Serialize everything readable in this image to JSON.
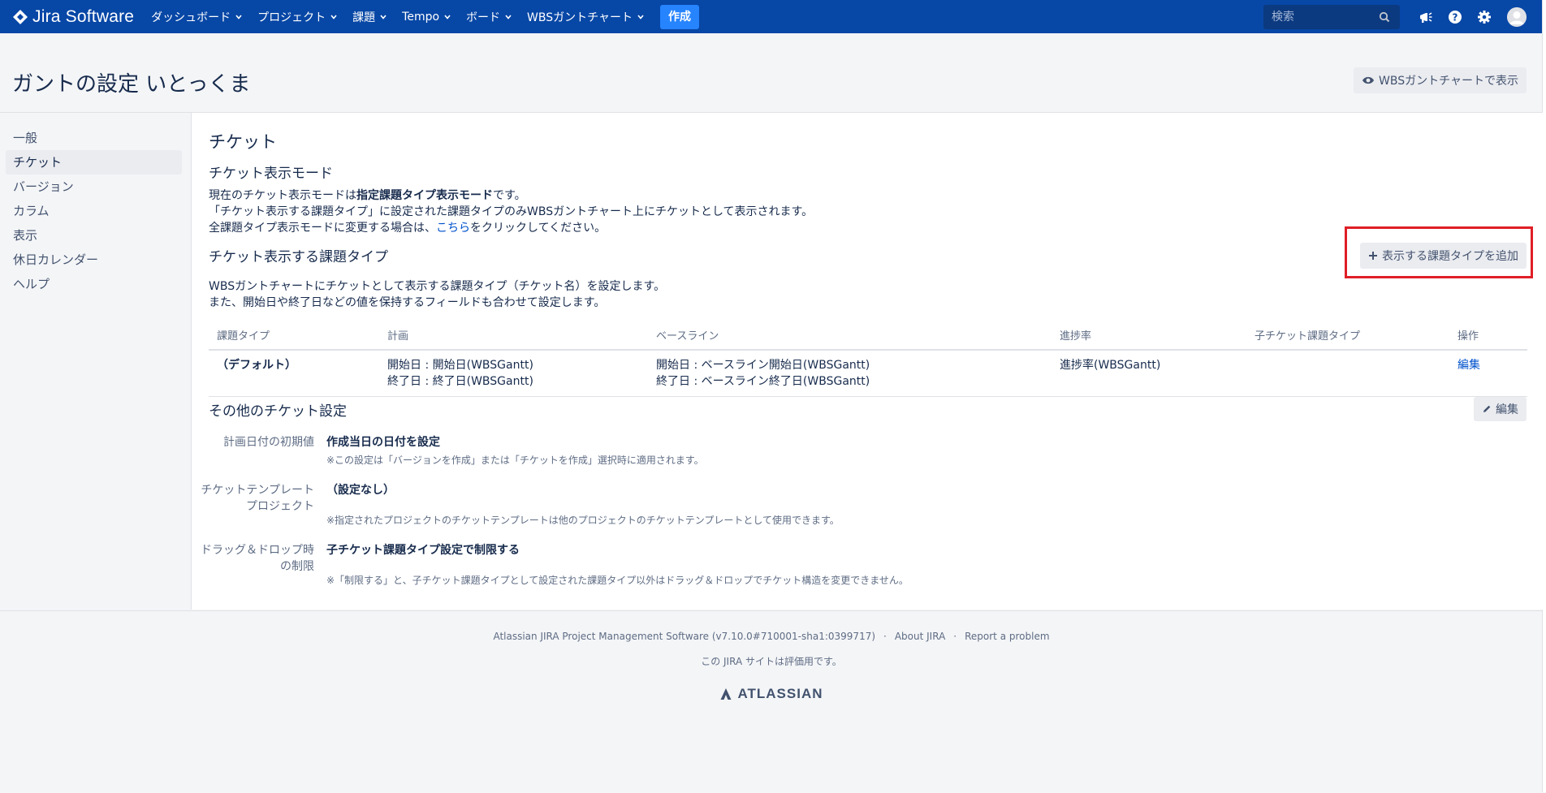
{
  "app": {
    "name": "Jira Software",
    "brand_color": "#0747a6",
    "accent_color": "#2684ff",
    "highlight_color": "#e01e26"
  },
  "nav": {
    "items": [
      {
        "label": "ダッシュボード"
      },
      {
        "label": "プロジェクト"
      },
      {
        "label": "課題"
      },
      {
        "label": "Tempo"
      },
      {
        "label": "ボード"
      },
      {
        "label": "WBSガントチャート"
      }
    ],
    "create_label": "作成",
    "search_placeholder": "検索",
    "icons": [
      "notifications-icon",
      "help-icon",
      "settings-icon",
      "user-avatar"
    ]
  },
  "header": {
    "title": "ガントの設定 いとっくま",
    "view_button": "WBSガントチャートで表示"
  },
  "sidebar": {
    "items": [
      {
        "label": "一般",
        "active": false
      },
      {
        "label": "チケット",
        "active": true
      },
      {
        "label": "バージョン",
        "active": false
      },
      {
        "label": "カラム",
        "active": false
      },
      {
        "label": "表示",
        "active": false
      },
      {
        "label": "休日カレンダー",
        "active": false
      },
      {
        "label": "ヘルプ",
        "active": false
      }
    ]
  },
  "main": {
    "section_title": "チケット",
    "mode": {
      "title": "チケット表示モード",
      "line1_prefix": "現在のチケット表示モードは",
      "line1_bold": "指定課題タイプ表示モード",
      "line1_suffix": "です。",
      "line2": "「チケット表示する課題タイプ」に設定された課題タイプのみWBSガントチャート上にチケットとして表示されます。",
      "line3_prefix": "全課題タイプ表示モードに変更する場合は、",
      "line3_link": "こちら",
      "line3_suffix": "をクリックしてください。"
    },
    "types": {
      "title": "チケット表示する課題タイプ",
      "add_button": "表示する課題タイプを追加",
      "desc1": "WBSガントチャートにチケットとして表示する課題タイプ（チケット名）を設定します。",
      "desc2": "また、開始日や終了日などの値を保持するフィールドも合わせて設定します。",
      "columns": [
        "課題タイプ",
        "計画",
        "ベースライン",
        "進捗率",
        "子チケット課題タイプ",
        "操作"
      ],
      "rows": [
        {
          "type": "（デフォルト）",
          "plan_start": "開始日 : 開始日(WBSGantt)",
          "plan_end": "終了日 : 終了日(WBSGantt)",
          "base_start": "開始日 : ベースライン開始日(WBSGantt)",
          "base_end": "終了日 : ベースライン終了日(WBSGantt)",
          "progress": "進捗率(WBSGantt)",
          "child": "",
          "action": "編集"
        }
      ]
    },
    "other": {
      "title": "その他のチケット設定",
      "edit_button": "編集",
      "settings": [
        {
          "label": "計画日付の初期値",
          "value": "作成当日の日付を設定",
          "note": "※この設定は「バージョンを作成」または「チケットを作成」選択時に適用されます。"
        },
        {
          "label": "チケットテンプレートプロジェクト",
          "value": "（設定なし）",
          "note": "※指定されたプロジェクトのチケットテンプレートは他のプロジェクトのチケットテンプレートとして使用できます。"
        },
        {
          "label": "ドラッグ＆ドロップ時の制限",
          "value": "子チケット課題タイプ設定で制限する",
          "note": "※「制限する」と、子チケット課題タイプとして設定された課題タイプ以外はドラッグ＆ドロップでチケット構造を変更できません。"
        }
      ]
    }
  },
  "footer": {
    "version": "Atlassian JIRA Project Management Software (v7.10.0#710001-sha1:0399717)",
    "about": "About JIRA",
    "report": "Report a problem",
    "eval_note": "この JIRA サイトは評価用です。",
    "logo_text": "ATLASSIAN"
  }
}
